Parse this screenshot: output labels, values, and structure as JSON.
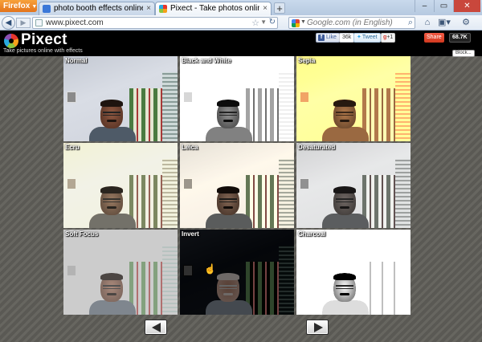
{
  "browser": {
    "app_button": "Firefox",
    "tabs": [
      {
        "title": "photo booth effects online - Go...",
        "active": false,
        "favicon_color": "#3b78d8"
      },
      {
        "title": "Pixect - Take photos online with...",
        "active": true,
        "favicon_color": "#e8352b"
      }
    ],
    "new_tab": "+",
    "window_controls": {
      "minimize": "–",
      "maximize": "▭",
      "close": "✕"
    },
    "url": "www.pixect.com",
    "search_placeholder": "Google.com (in English)"
  },
  "site": {
    "logo": "Pixect",
    "tagline": "Take pictures online with effects",
    "share": {
      "fb_like_label": "Like",
      "fb_count": "36k",
      "tweet_label": "Tweet",
      "gplus_label": "+1",
      "share_label": "Share",
      "share_count": "68.7K"
    },
    "blocked_label": "Block..."
  },
  "effects": [
    {
      "label": "Normal"
    },
    {
      "label": "Black and White"
    },
    {
      "label": "Sepia"
    },
    {
      "label": "Ecru"
    },
    {
      "label": "Leica"
    },
    {
      "label": "Desaturated"
    },
    {
      "label": "Soft Focus"
    },
    {
      "label": "Invert"
    },
    {
      "label": "Charcoal"
    }
  ]
}
